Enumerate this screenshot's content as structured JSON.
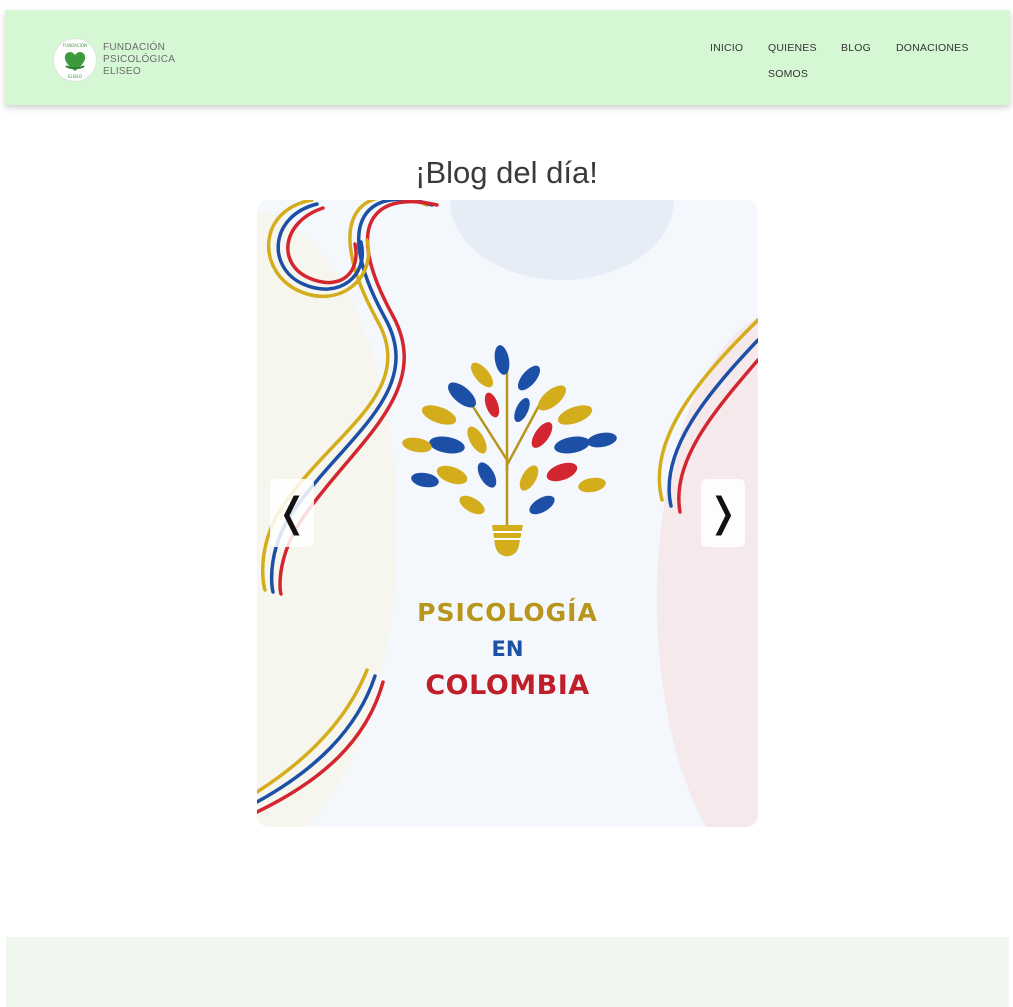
{
  "header": {
    "logo": {
      "line1": "FUNDACIÓN",
      "line2": "PSICOLÓGICA",
      "line3": "ELISEO",
      "icon": "heart-hands-logo",
      "badge_top": "FUNDACIÓN",
      "badge_bottom": "ELISEO"
    },
    "nav": {
      "inicio": "INICIO",
      "quienes": "QUIENES",
      "somos": "SOMOS",
      "blog": "BLOG",
      "donaciones": "DONACIONES"
    },
    "background": "#d5f7d4"
  },
  "main": {
    "title": "¡Blog del día!",
    "carousel": {
      "slide": {
        "line1": "PSICOLOGÍA",
        "line2": "EN",
        "line3": "COLOMBIA",
        "image": "tree-lightbulb-illustration"
      },
      "prev_icon": "chevron-left-icon",
      "next_icon": "chevron-right-icon",
      "prev_glyph": "❬",
      "next_glyph": "❭"
    }
  },
  "colors": {
    "yellow": "#d4ad1c",
    "blue": "#1c4fa6",
    "red": "#d42630",
    "footer": "#f0f7ef"
  }
}
